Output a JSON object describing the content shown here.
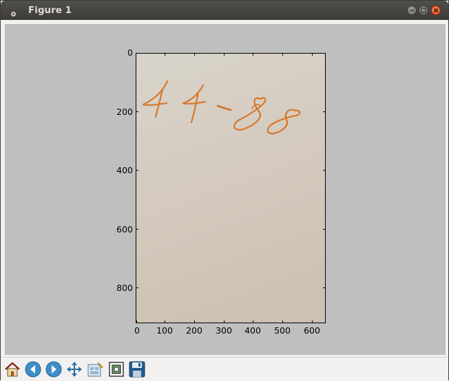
{
  "window": {
    "title": "Figure 1",
    "controls": [
      "minimize-icon",
      "maximize-icon",
      "close-icon"
    ]
  },
  "figure": {
    "background": "#bfbfbf",
    "image_content": "44-88",
    "y_ticks": [
      "0",
      "200",
      "400",
      "600",
      "800"
    ],
    "x_ticks": [
      "0",
      "100",
      "200",
      "300",
      "400",
      "500",
      "600"
    ]
  },
  "toolbar": {
    "icons": [
      "home-icon",
      "back-icon",
      "forward-icon",
      "pan-icon",
      "subplots-icon",
      "zoom-icon",
      "save-icon"
    ]
  },
  "colors": {
    "titlebar": "#3c3b37",
    "close": "#e1461b",
    "ink": "#d9701e",
    "paper": "#d3c8bb"
  }
}
